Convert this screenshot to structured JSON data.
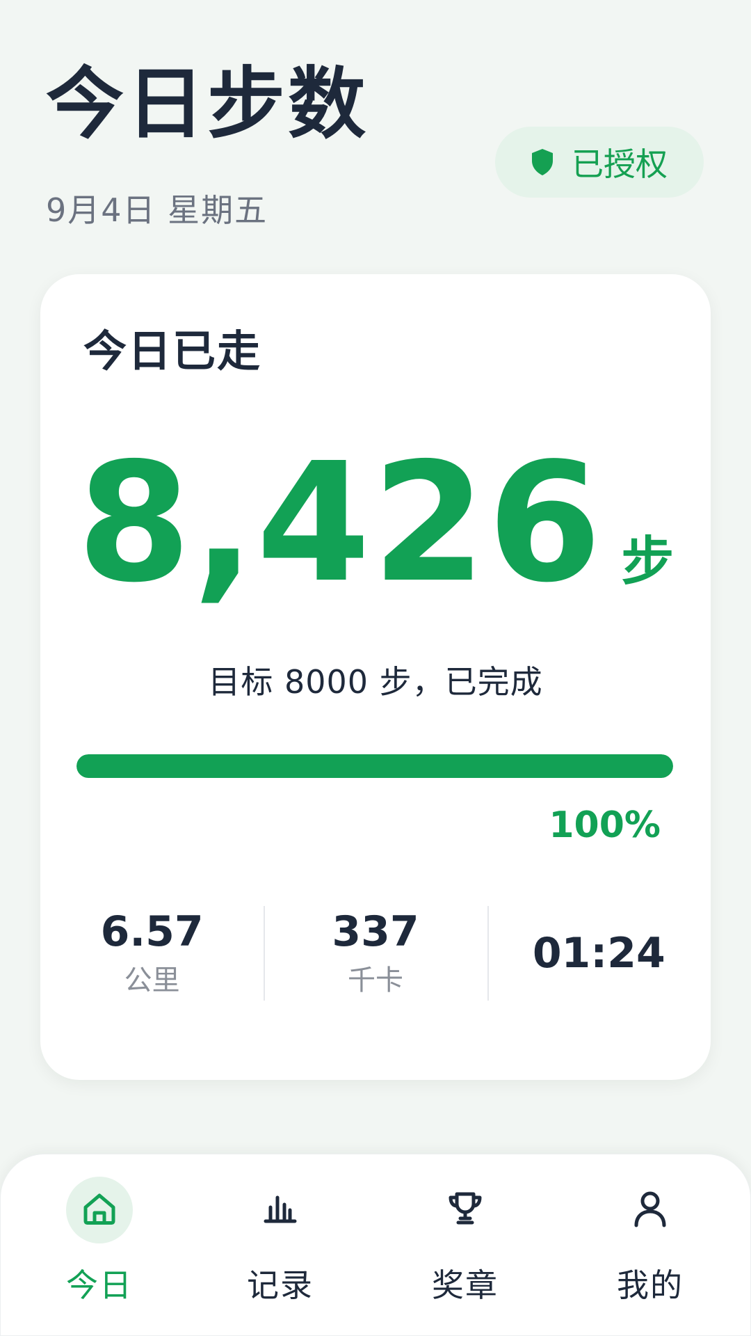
{
  "header": {
    "title": "今日步数",
    "date": "9月4日 星期五",
    "auth_badge": "已授权"
  },
  "card": {
    "title": "今日已走",
    "steps": "8,426",
    "steps_unit": "步",
    "goal_text": "目标 8000 步，已完成",
    "progress_fraction": 1.0,
    "progress_label": "100%",
    "stats": [
      {
        "value": "6.57",
        "label": "公里"
      },
      {
        "value": "337",
        "label": "千卡"
      },
      {
        "value": "01:24",
        "label": ""
      }
    ]
  },
  "tabbar": {
    "items": [
      {
        "label": "今日",
        "icon": "home-icon",
        "active": true
      },
      {
        "label": "记录",
        "icon": "bar-chart-icon",
        "active": false
      },
      {
        "label": "奖章",
        "icon": "trophy-icon",
        "active": false
      },
      {
        "label": "我的",
        "icon": "user-icon",
        "active": false
      }
    ]
  },
  "colors": {
    "accent": "#12a155",
    "badge_bg": "#e5f3ea",
    "text_dark": "#1e293b",
    "text_muted": "#6b7280",
    "background": "#f2f6f3"
  }
}
